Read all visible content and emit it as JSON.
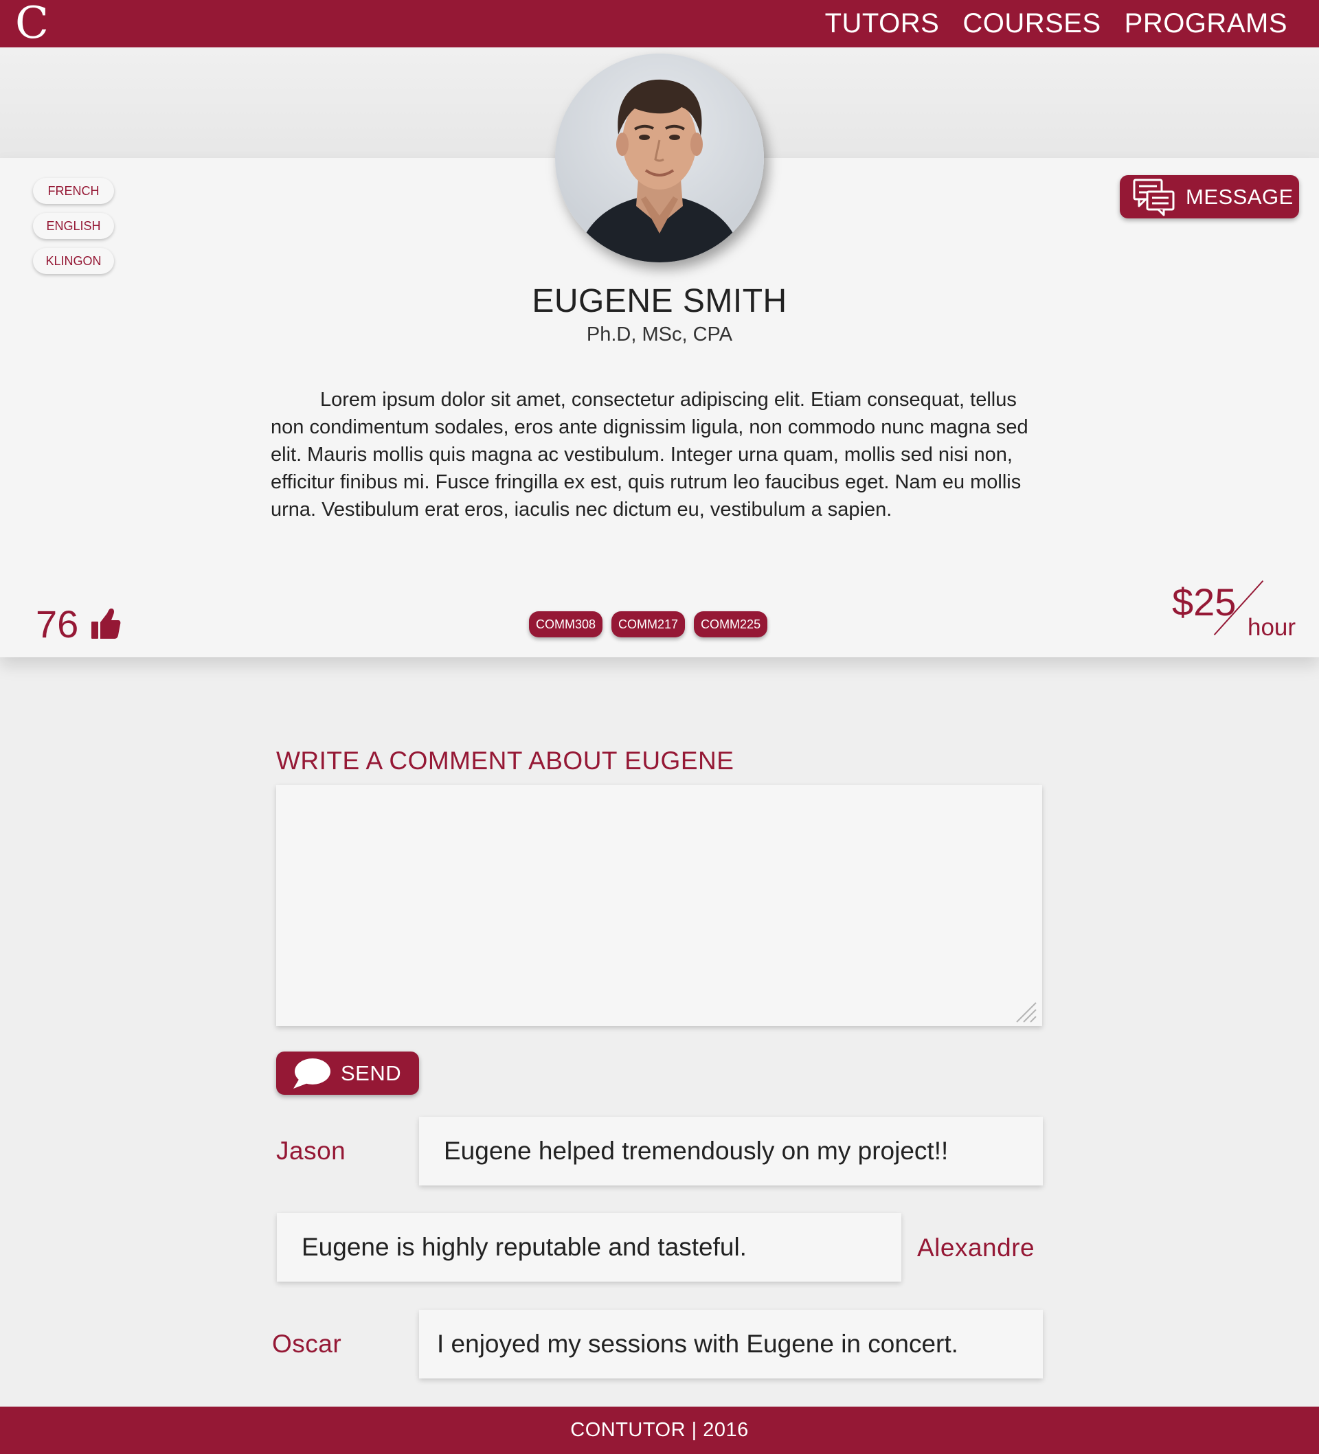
{
  "nav": {
    "logo": "C",
    "items": [
      "TUTORS",
      "COURSES",
      "PROGRAMS"
    ]
  },
  "profile": {
    "name": "EUGENE SMITH",
    "degrees": "Ph.D, MSc, CPA",
    "languages": [
      "FRENCH",
      "ENGLISH",
      "KLINGON"
    ],
    "message_label": "MESSAGE",
    "bio": "Lorem ipsum dolor sit amet, consectetur adipiscing elit. Etiam consequat, tellus non condimentum sodales, eros ante dignissim ligula, non commodo nunc magna sed elit. Mauris mollis quis magna ac vestibulum. Integer urna quam, mollis sed nisi non, efficitur finibus mi. Fusce fringilla ex est, quis rutrum leo faucibus eget. Nam eu mollis urna. Vestibulum erat eros, iaculis nec dictum eu, vestibulum a sapien.",
    "likes": "76",
    "courses": [
      "COMM308",
      "COMM217",
      "COMM225"
    ],
    "rate_amount": "$25",
    "rate_unit": "hour"
  },
  "comment_form": {
    "heading": "WRITE A COMMENT ABOUT EUGENE",
    "value": "",
    "send_label": "SEND"
  },
  "comments": [
    {
      "author": "Jason",
      "text": "Eugene helped tremendously on my project!!"
    },
    {
      "author": "Alexandre",
      "text": "Eugene is highly reputable and tasteful."
    },
    {
      "author": "Oscar",
      "text": "I enjoyed my sessions with Eugene in concert."
    }
  ],
  "footer": {
    "text": "CONTUTOR | 2016"
  },
  "colors": {
    "brand": "#951835",
    "background": "#efefef",
    "card": "#f5f5f5"
  },
  "icons": {
    "message": "chat-bubbles-icon",
    "like": "thumbs-up-icon",
    "send": "speech-bubble-icon"
  }
}
